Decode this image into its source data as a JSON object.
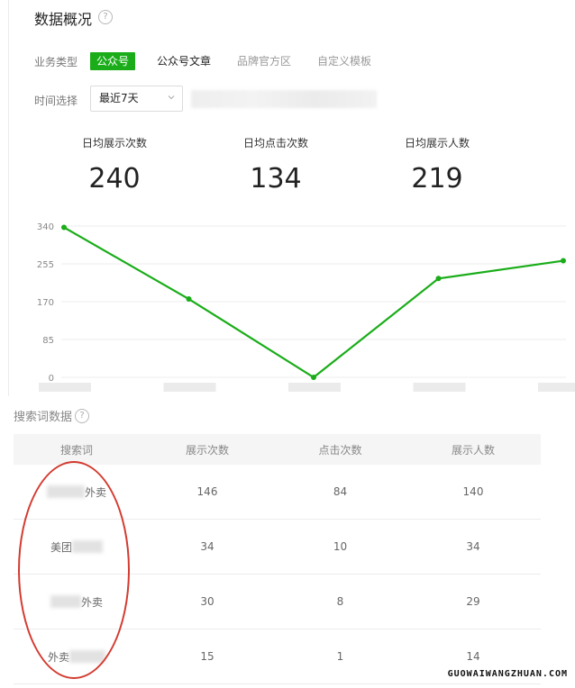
{
  "header": {
    "title": "数据概况",
    "help": "?"
  },
  "filters": {
    "business_type_label": "业务类型",
    "tabs": [
      {
        "label": "公众号",
        "active": true
      },
      {
        "label": "公众号文章",
        "active": false
      },
      {
        "label": "品牌官方区",
        "active": false
      },
      {
        "label": "自定义模板",
        "active": false
      }
    ],
    "time_label": "时间选择",
    "time_value": "最近7天"
  },
  "metrics": [
    {
      "label": "日均展示次数",
      "value": "240"
    },
    {
      "label": "日均点击次数",
      "value": "134"
    },
    {
      "label": "日均展示人数",
      "value": "219"
    }
  ],
  "chart_data": {
    "type": "line",
    "y_ticks": [
      "340",
      "255",
      "170",
      "85",
      "0"
    ],
    "ylim": [
      0,
      340
    ],
    "x": [
      0,
      1,
      2,
      3,
      4
    ],
    "values": [
      337,
      176,
      0,
      222,
      262
    ],
    "color": "#1aad19",
    "grid": true
  },
  "search_section": {
    "title": "搜索词数据",
    "help": "?"
  },
  "table": {
    "columns": [
      "搜索词",
      "展示次数",
      "点击次数",
      "展示人数"
    ],
    "rows": [
      {
        "term": "外卖",
        "impressions": "146",
        "clicks": "84",
        "reach": "140"
      },
      {
        "term": "美团",
        "impressions": "34",
        "clicks": "10",
        "reach": "34"
      },
      {
        "term": "外卖",
        "impressions": "30",
        "clicks": "8",
        "reach": "29"
      },
      {
        "term": "外卖",
        "impressions": "15",
        "clicks": "1",
        "reach": "14"
      }
    ]
  },
  "watermark": "GUOWAIWANGZHUAN.COM",
  "colors": {
    "accent": "#1aad19",
    "annotation": "#d33a2f"
  }
}
